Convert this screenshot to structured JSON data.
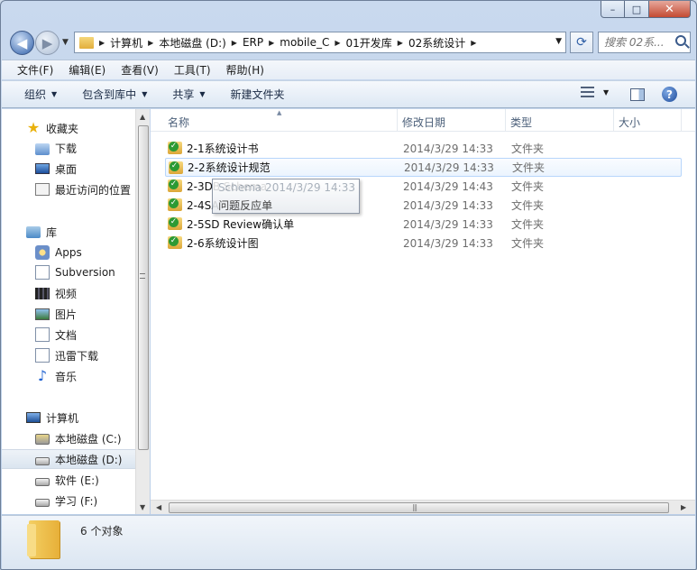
{
  "window": {
    "caption_buttons": {
      "minimize": "–",
      "maximize": "□",
      "close": "✕"
    }
  },
  "address_bar": {
    "crumbs": [
      "计算机",
      "本地磁盘 (D:)",
      "ERP",
      "mobile_C",
      "01开发库",
      "02系统设计"
    ],
    "separator": "▶",
    "dropdown": "▼"
  },
  "search": {
    "placeholder": "搜索 02系..."
  },
  "menu": [
    "文件(F)",
    "编辑(E)",
    "查看(V)",
    "工具(T)",
    "帮助(H)"
  ],
  "toolbar": {
    "organize": "组织",
    "include_in_library": "包含到库中",
    "share": "共享",
    "new_folder": "新建文件夹",
    "arrow": "▼"
  },
  "nav_pane": {
    "favorites": {
      "header": "收藏夹",
      "items": [
        "下载",
        "桌面",
        "最近访问的位置"
      ]
    },
    "libraries": {
      "header": "库",
      "items": [
        "Apps",
        "Subversion",
        "视频",
        "图片",
        "文档",
        "迅雷下载",
        "音乐"
      ]
    },
    "computer": {
      "header": "计算机",
      "items": [
        "本地磁盘 (C:)",
        "本地磁盘 (D:)",
        "软件 (E:)",
        "学习 (F:)"
      ]
    },
    "selected": "本地磁盘 (D:)"
  },
  "columns": {
    "name": "名称",
    "date": "修改日期",
    "type": "类型",
    "size": "大小"
  },
  "files": [
    {
      "name": "2-1系统设计书",
      "date": "2014/3/29 14:33",
      "type": "文件夹"
    },
    {
      "name": "2-2系统设计规范",
      "date": "2014/3/29 14:33",
      "type": "文件夹"
    },
    {
      "name": "2-3DB Schema",
      "date": "2014/3/29 14:43",
      "type": "文件夹"
    },
    {
      "name": "2-4SA问题反应单",
      "date": "2014/3/29 14:33",
      "type": "文件夹"
    },
    {
      "name": "2-5SD Review确认单",
      "date": "2014/3/29 14:33",
      "type": "文件夹"
    },
    {
      "name": "2-6系统设计图",
      "date": "2014/3/29 14:33",
      "type": "文件夹"
    }
  ],
  "tooltip": {
    "line1": "Schema 2014/3/29 14:33",
    "line2": "问题反应单"
  },
  "status": {
    "count_text": "6 个对象"
  },
  "colors": {
    "accent": "#2e5ea8",
    "hover_border": "#b8d6fb",
    "check_green": "#2d9a34"
  }
}
